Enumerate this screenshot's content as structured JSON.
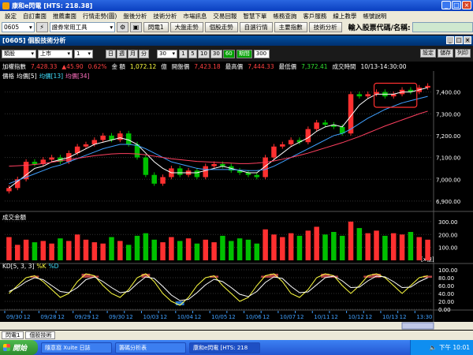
{
  "window": {
    "title": "康和e閃電 [HTS: 218.38]"
  },
  "menu": [
    "設定",
    "自訂畫面",
    "推薦畫面",
    "行情走勢(圖)",
    "盤後分析",
    "技術分析",
    "市場訊息",
    "交易回報",
    "智慧下單",
    "帳務查詢",
    "客戶服務",
    "線上教學",
    "帳號說明"
  ],
  "toolbar": {
    "code": "0605",
    "tool_select": "證券常用工具",
    "buttons": [
      "閃電1",
      "大盤走勢",
      "個股走勢",
      "自選行情",
      "主要指數",
      "技術分析"
    ],
    "stock_label": "輸入股票代碼/名稱:"
  },
  "chart_window": {
    "title": "[0605] 個股技術分析",
    "stock_select": "類股",
    "market_select": "上市",
    "box_value": "1",
    "period_buttons": [
      "日",
      "週",
      "月",
      "分"
    ],
    "minute_select": "30",
    "minute_buttons": [
      "1",
      "5",
      "10",
      "30",
      "60"
    ],
    "active_button": "60",
    "custom_label": "期間",
    "custom_value": "300",
    "right_buttons": [
      "設定",
      "儲存",
      "列印"
    ]
  },
  "quote": {
    "name": "加權指數",
    "price": "7,428.33",
    "change": "▲45.90",
    "pct": "0.62%",
    "amount_label": "金 額",
    "amount": "1,072.12",
    "unit_label": "億",
    "prev_label": "開盤價",
    "prev": "7,423.18",
    "high_label": "最高價",
    "high": "7,444.33",
    "low_label": "最低價",
    "low": "7,372.41",
    "time_label": "成交時間",
    "time": "10/13-14:30:00"
  },
  "panels": {
    "price_legend": [
      "價格",
      "均價[5]",
      "均價[13]",
      "均價[34]"
    ],
    "volume_legend": "成交金額",
    "volume_unit": "[x億]",
    "kd_legend": [
      "KD[5, 3, 3]",
      "%K",
      "%D"
    ]
  },
  "price_axis": [
    "7,400.00",
    "7,300.00",
    "7,200.00",
    "7,100.00",
    "7,000.00",
    "6,900.00"
  ],
  "volume_axis": [
    "300.00",
    "200.00",
    "100.00"
  ],
  "kd_axis": [
    "100.00",
    "80.00",
    "60.00",
    "40.00",
    "20.00",
    "0.00"
  ],
  "x_labels": [
    "09/30",
    "12",
    "09/28",
    "12",
    "09/29",
    "12",
    "09/30",
    "12",
    "10/03",
    "12",
    "10/04",
    "12",
    "10/05",
    "12",
    "10/06",
    "12",
    "10/07",
    "12",
    "10/11",
    "12",
    "10/12",
    "12",
    "10/13",
    "12",
    "13:30"
  ],
  "chart_data": {
    "type": "candlestick",
    "x": [
      "09/30",
      "12",
      "09/28",
      "12",
      "09/29",
      "12",
      "09/30",
      "12",
      "10/03",
      "12",
      "10/04",
      "12",
      "10/05",
      "12",
      "10/06",
      "12",
      "10/07",
      "12",
      "10/11",
      "12",
      "10/12",
      "12",
      "10/13",
      "12",
      "13:30"
    ],
    "price_ylim": [
      6860,
      7460
    ],
    "close": [
      6960,
      7000,
      7080,
      7070,
      7090,
      7100,
      7080,
      7120,
      7150,
      7160,
      7180,
      7200,
      7180,
      7210,
      7160,
      7100,
      7020,
      6980,
      7010,
      7050,
      7020,
      7040,
      7010,
      7060,
      7070,
      7060,
      7040,
      7030,
      7020,
      7010,
      7100,
      7150,
      7160,
      7180,
      7170,
      7230,
      7260,
      7250,
      7240,
      7210,
      7390,
      7380,
      7390,
      7400,
      7380,
      7390,
      7410,
      7400,
      7420,
      7428
    ],
    "ma5": [
      6960,
      6990,
      7020,
      7050,
      7060,
      7080,
      7090,
      7100,
      7120,
      7140,
      7160,
      7170,
      7180,
      7190,
      7180,
      7160,
      7120,
      7080,
      7050,
      7030,
      7030,
      7030,
      7030,
      7040,
      7050,
      7060,
      7050,
      7040,
      7030,
      7030,
      7060,
      7090,
      7120,
      7150,
      7170,
      7190,
      7220,
      7240,
      7250,
      7240,
      7290,
      7340,
      7370,
      7390,
      7390,
      7390,
      7400,
      7400,
      7410,
      7420
    ],
    "ma13": [
      6980,
      6995,
      7010,
      7025,
      7040,
      7055,
      7065,
      7080,
      7095,
      7110,
      7125,
      7140,
      7150,
      7160,
      7160,
      7155,
      7140,
      7120,
      7100,
      7080,
      7070,
      7060,
      7050,
      7045,
      7045,
      7045,
      7045,
      7042,
      7040,
      7040,
      7045,
      7060,
      7080,
      7100,
      7120,
      7140,
      7160,
      7180,
      7200,
      7210,
      7230,
      7255,
      7280,
      7300,
      7320,
      7335,
      7350,
      7360,
      7370,
      7380
    ],
    "ma34": [
      7060,
      7062,
      7064,
      7068,
      7072,
      7078,
      7084,
      7090,
      7096,
      7102,
      7108,
      7112,
      7116,
      7118,
      7118,
      7116,
      7112,
      7106,
      7100,
      7094,
      7090,
      7086,
      7082,
      7080,
      7078,
      7076,
      7074,
      7072,
      7072,
      7074,
      7078,
      7084,
      7092,
      7100,
      7110,
      7120,
      7132,
      7144,
      7156,
      7168,
      7182,
      7196,
      7212,
      7228,
      7244,
      7258,
      7272,
      7286,
      7300,
      7312
    ],
    "volume_ylim": [
      0,
      330
    ],
    "volume": [
      180,
      120,
      160,
      140,
      150,
      130,
      170,
      150,
      200,
      160,
      140,
      130,
      180,
      150,
      120,
      190,
      210,
      160,
      140,
      180,
      150,
      170,
      130,
      160,
      140,
      190,
      150,
      170,
      160,
      130,
      240,
      200,
      180,
      210,
      190,
      230,
      260,
      200,
      220,
      190,
      300,
      250,
      210,
      230,
      190,
      210,
      200,
      220,
      180,
      160
    ],
    "kd_ylim": [
      0,
      100
    ],
    "k": [
      40,
      60,
      80,
      85,
      70,
      50,
      30,
      40,
      70,
      90,
      85,
      60,
      40,
      30,
      50,
      80,
      90,
      70,
      40,
      20,
      10,
      30,
      60,
      80,
      85,
      60,
      40,
      20,
      30,
      60,
      85,
      90,
      70,
      40,
      30,
      50,
      80,
      90,
      85,
      60,
      40,
      60,
      85,
      90,
      80,
      60,
      40,
      60,
      80,
      85
    ],
    "d": [
      45,
      55,
      70,
      80,
      75,
      60,
      45,
      42,
      55,
      75,
      82,
      70,
      55,
      42,
      45,
      65,
      82,
      78,
      58,
      36,
      22,
      25,
      42,
      62,
      76,
      70,
      55,
      38,
      32,
      45,
      68,
      82,
      78,
      58,
      42,
      44,
      62,
      80,
      84,
      72,
      55,
      56,
      72,
      84,
      82,
      70,
      55,
      56,
      70,
      80
    ]
  }
}
